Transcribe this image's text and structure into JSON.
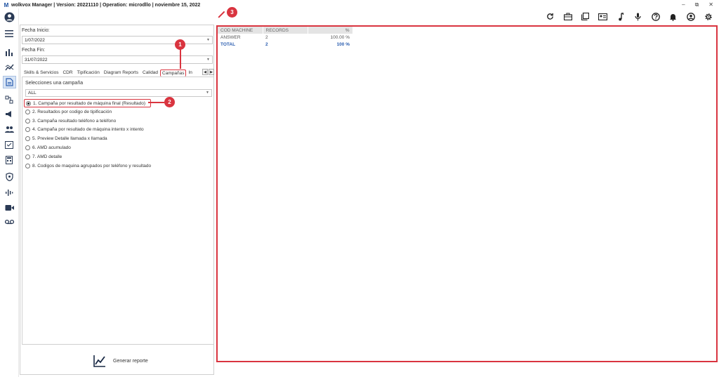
{
  "window": {
    "title": "wolkvox Manager  | Version: 20221110  | Operation: microdllo | noviembre 15, 2022",
    "logo_letter": "M",
    "controls": [
      "–",
      "⧉",
      "✕"
    ]
  },
  "filters": {
    "start_label": "Fecha Inicio:",
    "start_value": "1/07/2022",
    "end_label": "Fecha Fin:",
    "end_value": "31/07/2022"
  },
  "tabs": [
    {
      "label": "Skills & Servicios"
    },
    {
      "label": "CDR"
    },
    {
      "label": "Tipificación"
    },
    {
      "label": "Diagram Reports"
    },
    {
      "label": "Calidad"
    },
    {
      "label": "Campañas",
      "active": true
    },
    {
      "label": "In"
    }
  ],
  "tab_nav": {
    "prev": "◀",
    "next": "▶"
  },
  "campaign": {
    "select_label": "Selecciones una campaña",
    "select_value": "ALL"
  },
  "report_options": [
    {
      "label": "1. Campaña por resultado de máquina final (Resultado)",
      "selected": true
    },
    {
      "label": "2. Resultados por codigo de tipificación"
    },
    {
      "label": "3. Campaña resultado teléfono a teléfono"
    },
    {
      "label": "4. Campaña por resultado de máquina intento x intento"
    },
    {
      "label": "5. Preview Detalle llamada x llamada"
    },
    {
      "label": "6. AMD acumulado"
    },
    {
      "label": "7. AMD detalle"
    },
    {
      "label": "8. Codigos de maquina agrupados por teléfono y resultado"
    }
  ],
  "generate_label": "Generar reporte",
  "grid": {
    "columns": [
      "COD MACHINE",
      "RECORDS",
      "%"
    ],
    "rows": [
      {
        "cod": "ANSWER",
        "records": "2",
        "pct": "100.00 %"
      }
    ],
    "total": {
      "cod": "TOTAL",
      "records": "2",
      "pct": "100 %"
    }
  },
  "annotations": [
    "1",
    "2",
    "3"
  ],
  "colors": {
    "annotation": "#d9343f",
    "total_text": "#2a5db0"
  }
}
